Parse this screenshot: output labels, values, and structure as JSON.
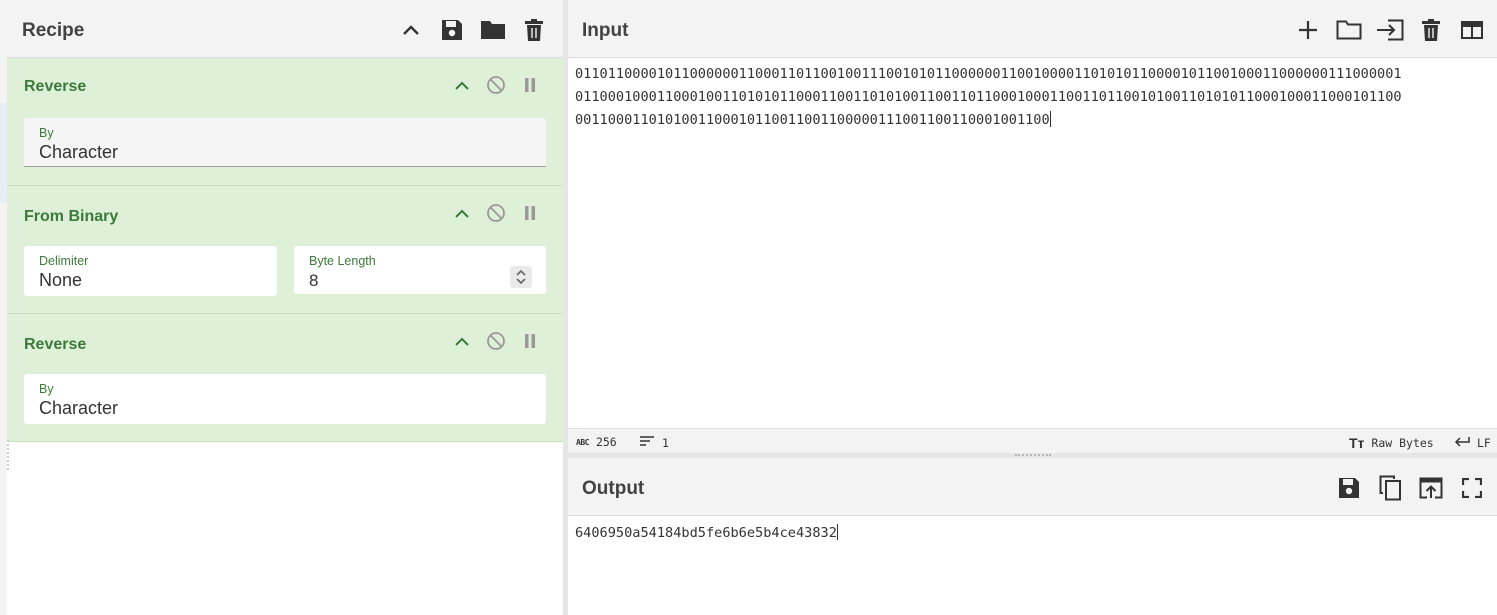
{
  "recipe": {
    "title": "Recipe",
    "icons": [
      "chevron-up-icon",
      "save-icon",
      "folder-icon",
      "trash-icon"
    ],
    "operations": [
      {
        "name": "Reverse",
        "args": [
          {
            "label": "By",
            "value": "Character"
          }
        ]
      },
      {
        "name": "From Binary",
        "args": [
          {
            "label": "Delimiter",
            "value": "None"
          },
          {
            "label": "Byte Length",
            "value": "8"
          }
        ]
      },
      {
        "name": "Reverse",
        "args": [
          {
            "label": "By",
            "value": "Character"
          }
        ]
      }
    ],
    "op_icons": [
      "chevron-up-icon",
      "disable-icon",
      "pause-icon"
    ]
  },
  "input": {
    "title": "Input",
    "icons": [
      "plus-icon",
      "folder-icon",
      "import-icon",
      "trash-icon",
      "layout-icon"
    ],
    "lines": [
      "01101100001011000000110001101100100111001010110000001100100001101010110000101100100011000000111000001",
      "01100010001100010011010101100011001101010011001101100010001100110110010100110101011000100011000101100",
      "001100011010100110001011001100110000011100110011000100110Ø"
    ],
    "status": {
      "chars_icon": "abc-icon",
      "chars": "256",
      "lines_icon": "lines-icon",
      "lines": "1",
      "encoding_icon": "text-size-icon",
      "encoding": "Raw Bytes",
      "eol_icon": "return-icon",
      "eol": "LF"
    }
  },
  "output": {
    "title": "Output",
    "icons": [
      "save-icon",
      "copy-icon",
      "replace-input-icon",
      "fullscreen-icon"
    ],
    "text": "6406950a54184bd5fe6b6e5b4ce43832"
  },
  "colors": {
    "op_bg": "#dff0d8",
    "op_title": "#3c7a3c",
    "header_bg": "#f3f3f3"
  }
}
